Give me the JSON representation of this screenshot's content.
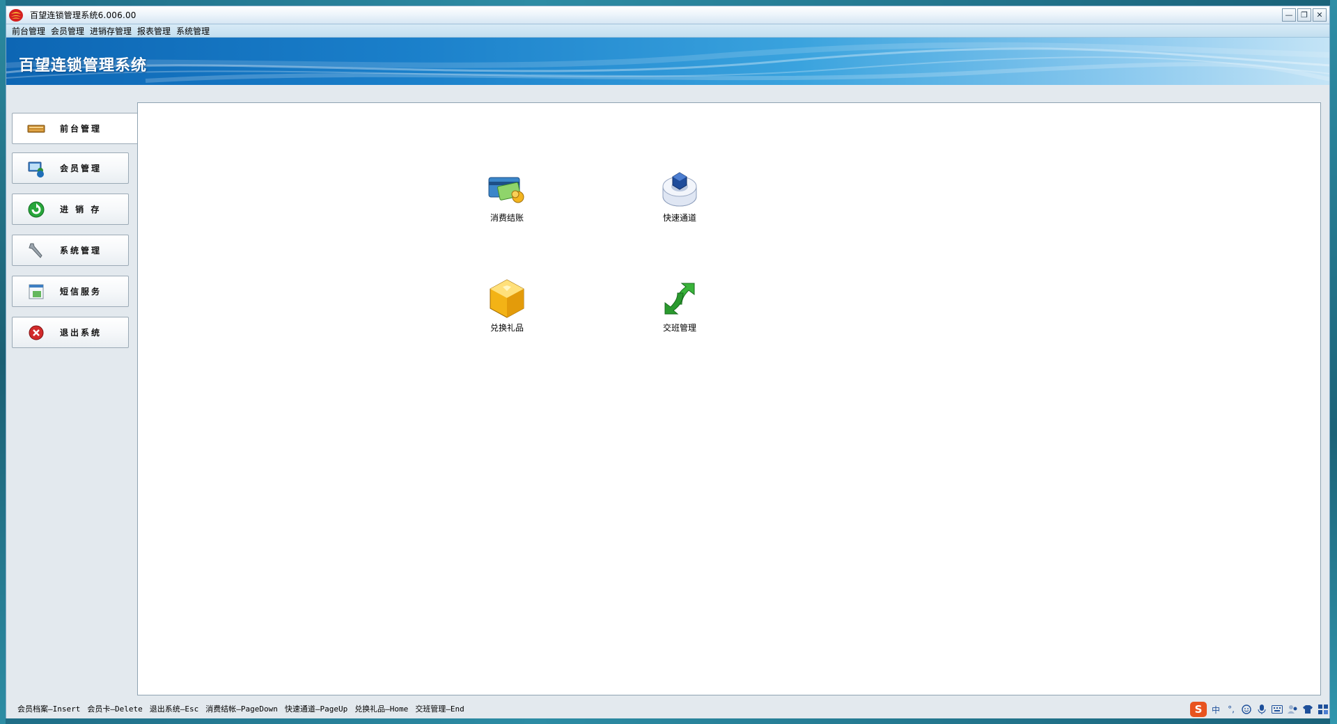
{
  "window": {
    "title": "百望连锁管理系统6.006.00",
    "controls": {
      "minimize": "—",
      "restore": "❐",
      "close": "✕"
    }
  },
  "menubar": {
    "items": [
      "前台管理",
      "会员管理",
      "进销存管理",
      "报表管理",
      "系统管理"
    ]
  },
  "banner": {
    "title": "百望连锁管理系统"
  },
  "nav": {
    "items": [
      {
        "label": "前台管理",
        "icon": "register-icon"
      },
      {
        "label": "会员管理",
        "icon": "member-icon"
      },
      {
        "label": "进 销 存",
        "icon": "inventory-icon"
      },
      {
        "label": "系统管理",
        "icon": "wrench-icon"
      },
      {
        "label": "短信服务",
        "icon": "sms-icon"
      },
      {
        "label": "退出系统",
        "icon": "exit-icon"
      }
    ]
  },
  "tiles": [
    {
      "label": "消费结账",
      "icon": "checkout-icon"
    },
    {
      "label": "快速通道",
      "icon": "fast-channel-icon"
    },
    {
      "label": "兑换礼品",
      "icon": "gift-exchange-icon"
    },
    {
      "label": "交班管理",
      "icon": "shift-handover-icon"
    }
  ],
  "status": {
    "shortcuts": [
      "会员档案—Insert",
      "会员卡—Delete",
      "退出系统—Esc",
      "消费结帐—PageDown",
      "快速通道—PageUp",
      "兑换礼品—Home",
      "交班管理—End"
    ]
  },
  "tray": {
    "brand": "S",
    "ime_mode": "中",
    "punct": "°,"
  },
  "colors": {
    "banner_start": "#0d66b4",
    "banner_end": "#c4e4f6",
    "nav_active_bg": "#ffffff",
    "window_bg": "#e3e9ee"
  }
}
